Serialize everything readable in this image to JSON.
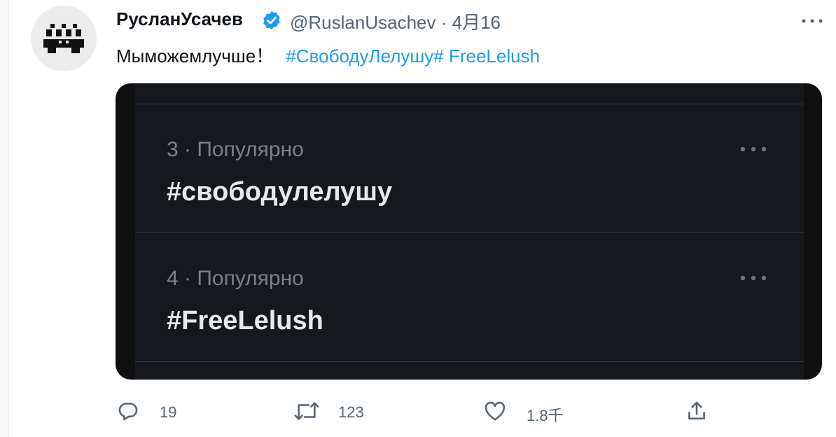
{
  "tweet": {
    "author_name": "РусланУсачев",
    "handle": "@RuslanUsachev",
    "separator": "·",
    "date": "4月16",
    "text": "Мыможемлучше！",
    "hashtag_1": "#СвободуЛелушу#",
    "hashtag_2": "FreeLelush",
    "verified_icon": "verified-badge-icon",
    "accent_color": "#1d9bf0"
  },
  "media": {
    "trends": [
      {
        "meta": "3 · Популярно",
        "tag": "#свободулелушу"
      },
      {
        "meta": "4 · Популярно",
        "tag": "#FreeLelush"
      }
    ]
  },
  "actions": {
    "reply_count": "19",
    "retweet_count": "123",
    "like_count": "1.8千",
    "icons": [
      "reply-icon",
      "retweet-icon",
      "like-icon",
      "share-icon"
    ]
  }
}
